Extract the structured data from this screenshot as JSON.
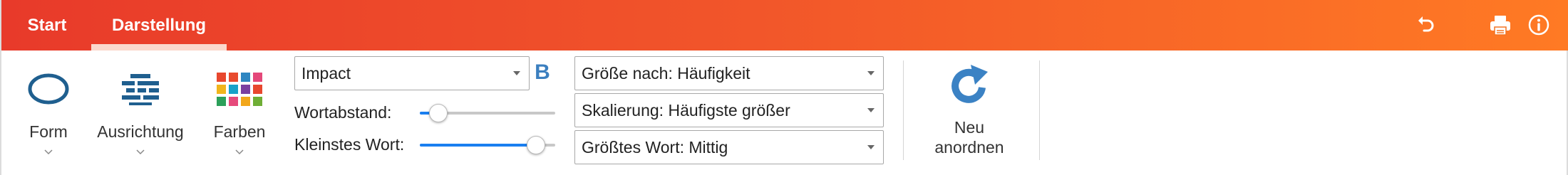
{
  "tabs": [
    {
      "label": "Start",
      "active": false
    },
    {
      "label": "Darstellung",
      "active": true
    }
  ],
  "header_icons": [
    "undo-icon",
    "print-icon",
    "info-icon"
  ],
  "colors": {
    "header_gradient": [
      "#e83a2a",
      "#ff7a24"
    ],
    "accent_blue": "#3b7fbf",
    "slider_fill": "#1a7ff0",
    "palette": [
      "#e8472e",
      "#e84a2e",
      "#2e86c1",
      "#e4487a",
      "#f1b51c",
      "#18a1c8",
      "#7a3fa0",
      "#e8472e",
      "#2ca05a",
      "#e64a7b",
      "#f2a71b",
      "#6fae35"
    ]
  },
  "ribbon": {
    "form": {
      "label": "Form",
      "icon": "ellipse-shape-icon"
    },
    "ausrichtung": {
      "label": "Ausrichtung",
      "icon": "brick-layout-icon"
    },
    "farben": {
      "label": "Farben",
      "icon": "color-palette-icon"
    },
    "font": {
      "value": "Impact",
      "bold_label": "B"
    },
    "wortabstand": {
      "label": "Wortabstand:",
      "value": 0.13
    },
    "kleinstes_wort": {
      "label": "Kleinstes Wort:",
      "value": 0.85
    },
    "groesse": {
      "value": "Größe nach: Häufigkeit"
    },
    "skalierung": {
      "value": "Skalierung: Häufigste größer"
    },
    "groesstes_wort": {
      "value": "Größtes Wort: Mittig"
    },
    "neu_anordnen": {
      "label_line1": "Neu",
      "label_line2": "anordnen",
      "icon": "refresh-icon"
    }
  }
}
